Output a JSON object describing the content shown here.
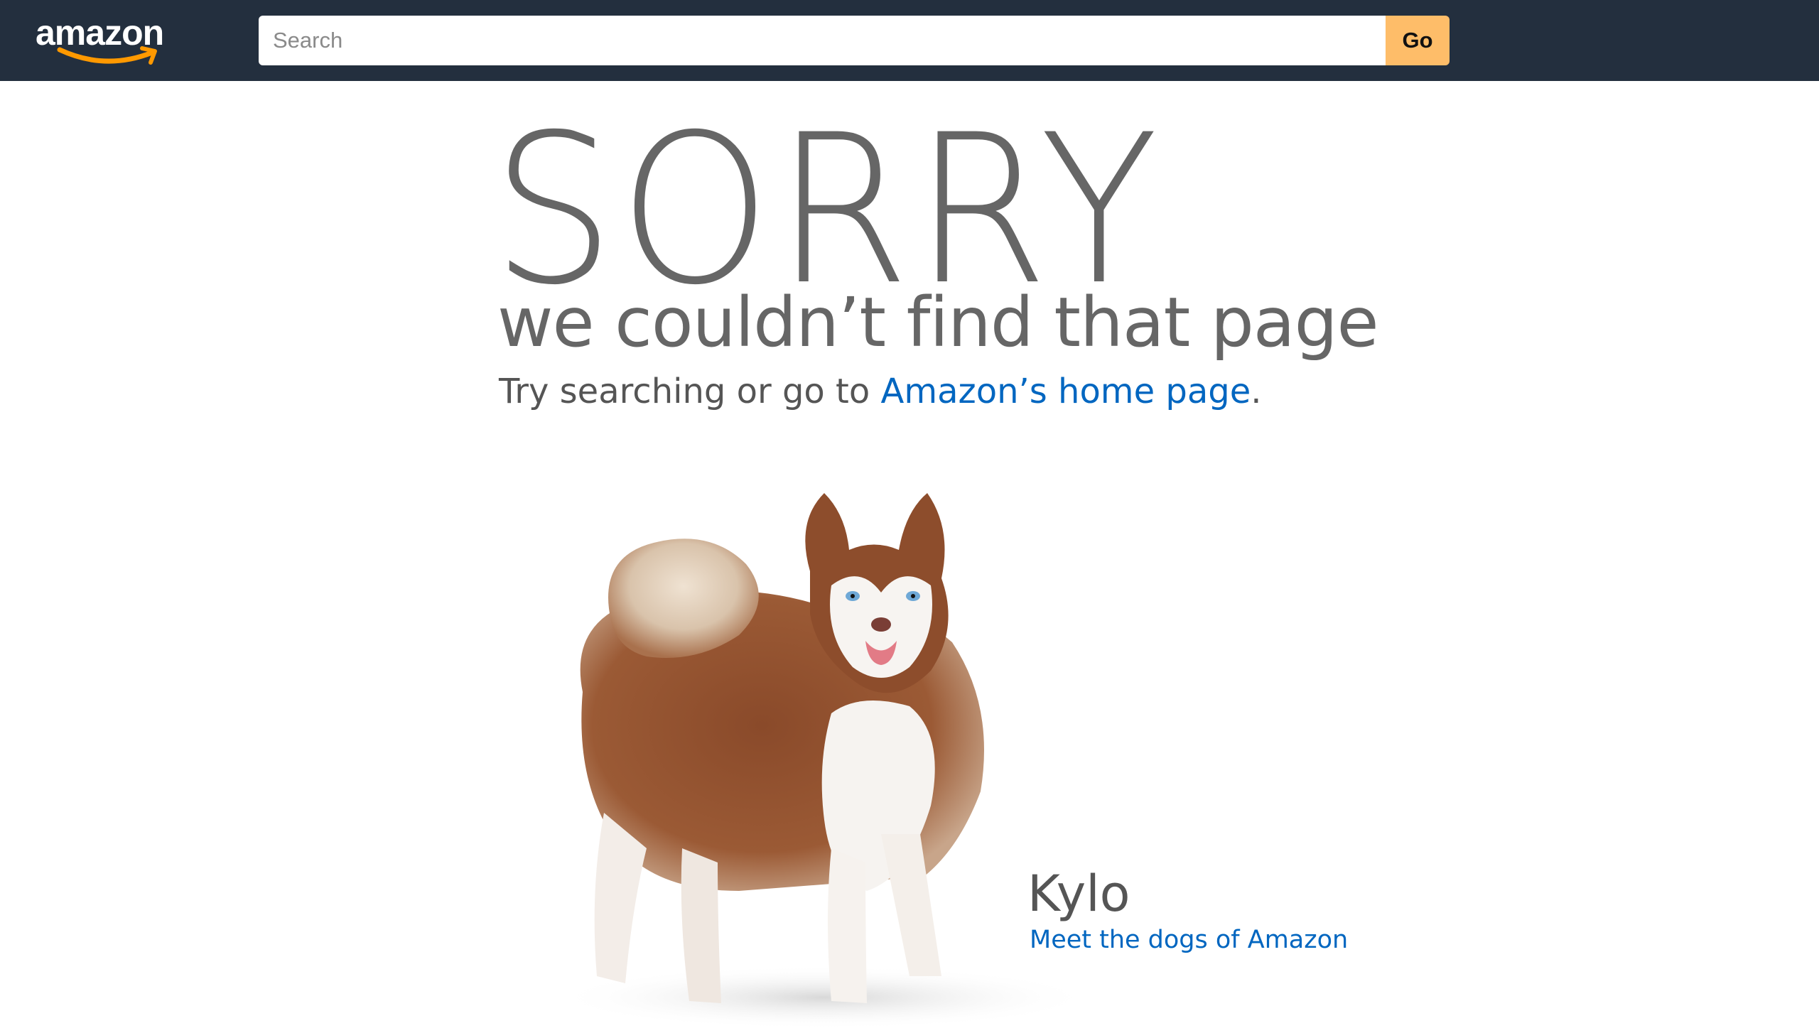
{
  "header": {
    "logo_text": "amazon",
    "logo_icon": "amazon-smile-logo",
    "search_placeholder": "Search",
    "search_value": "",
    "go_label": "Go",
    "colors": {
      "bar": "#232f3e",
      "go_button": "#febd69",
      "smile": "#ff9900"
    }
  },
  "error": {
    "headline": "SORRY",
    "subtitle": "we couldn’t find that page",
    "try_prefix": "Try searching or go to ",
    "home_link": "Amazon’s home page",
    "try_suffix": ".",
    "link_color": "#0066c0"
  },
  "dog": {
    "image": "husky-dog-photo",
    "name": "Kylo",
    "link": "Meet the dogs of Amazon"
  }
}
